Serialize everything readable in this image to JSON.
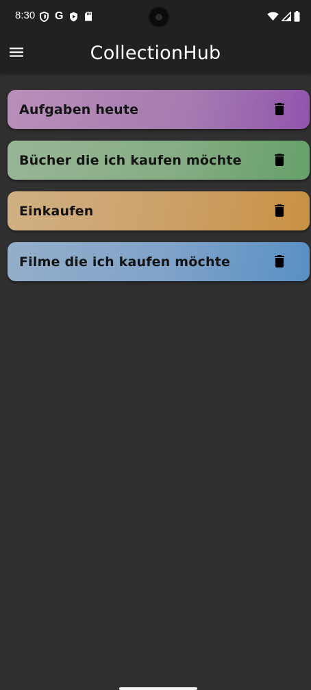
{
  "status_bar": {
    "time": "8:30",
    "left_icons": [
      "shield-icon",
      "google-g-icon",
      "play-protect-icon",
      "sd-card-icon"
    ],
    "google_letter": "G",
    "right_icons": [
      "wifi-icon",
      "cellular-signal-icon",
      "battery-icon"
    ]
  },
  "app_bar": {
    "title": "CollectionHub",
    "menu_icon": "hamburger-menu-icon"
  },
  "collections": [
    {
      "label": "Aufgaben heute",
      "color": "#9254ad",
      "delete_icon": "trash-icon"
    },
    {
      "label": "Bücher die ich kaufen möchte",
      "color": "#66a06a",
      "delete_icon": "trash-icon"
    },
    {
      "label": "Einkaufen",
      "color": "#c89142",
      "delete_icon": "trash-icon"
    },
    {
      "label": "Filme die ich kaufen möchte",
      "color": "#5890c3",
      "delete_icon": "trash-icon"
    }
  ],
  "colors": {
    "background": "#303030",
    "app_bar": "#212121",
    "title_text": "#ffffff",
    "card_text": "#141414"
  }
}
